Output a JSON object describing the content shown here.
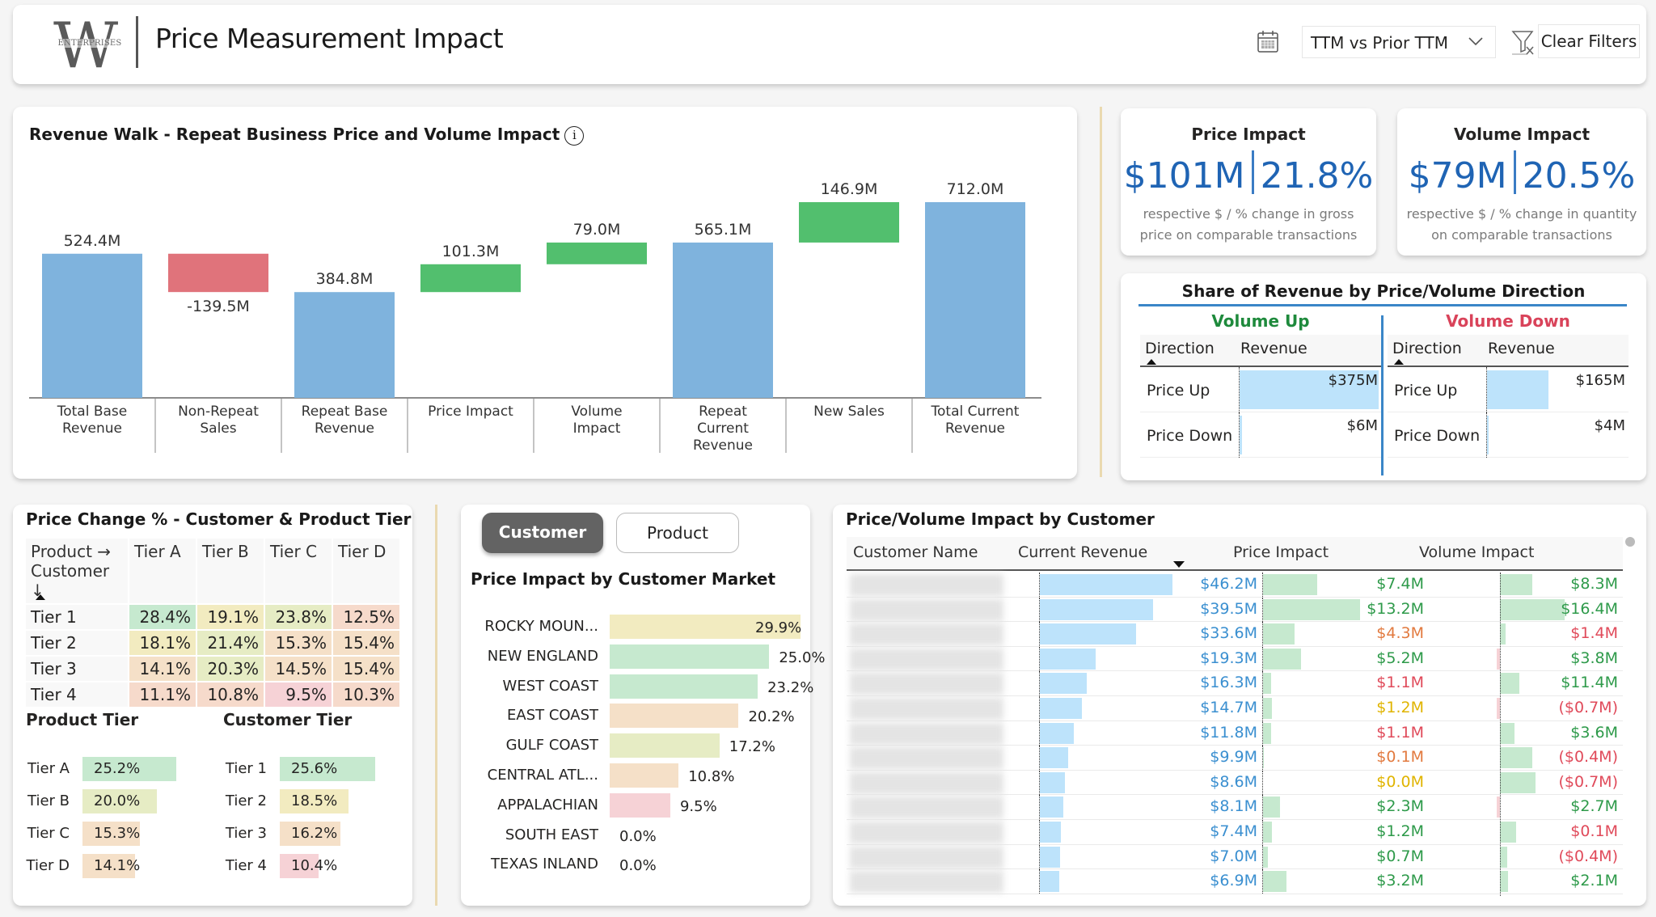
{
  "header": {
    "logo_letter": "W",
    "logo_text": "ENTERPRISES",
    "title": "Price Measurement Impact",
    "period_selected": "TTM vs Prior TTM",
    "clear_filters_label": "Clear Filters"
  },
  "colors": {
    "total_bar": "#7fb3dd",
    "increase_bar": "#52bf6e",
    "decrease_bar": "#e0737b",
    "kpi_value": "#1f64b4",
    "volume_up": "#1e8a3c",
    "volume_down": "#d9435a",
    "revenue_text": "#3a8fd0",
    "positive_text": "#2e9a4a",
    "negative_text": "#e04a5a",
    "warn_orange": "#e27a3f",
    "warn_yellow": "#e0b400",
    "green_fill": "#c6e9cf",
    "yellowgreen_fill": "#e6ecc4",
    "yellow_fill": "#f2ebc0",
    "orange_fill": "#f5e0c8",
    "pink_fill": "#f6d2d6",
    "blue_fill": "#bde3fb"
  },
  "walk": {
    "title": "Revenue Walk - Repeat Business Price and Volume Impact",
    "chart_data": {
      "type": "waterfall",
      "title": "Revenue Walk - Repeat Business Price and Volume Impact",
      "categories": [
        "Total Base Revenue",
        "Non-Repeat Sales",
        "Repeat Base Revenue",
        "Price Impact",
        "Volume Impact",
        "Repeat Current Revenue",
        "New Sales",
        "Total Current Revenue"
      ],
      "category_lines": [
        [
          "Total Base",
          "Revenue"
        ],
        [
          "Non-Repeat",
          "Sales"
        ],
        [
          "Repeat Base",
          "Revenue"
        ],
        [
          "Price Impact"
        ],
        [
          "Volume",
          "Impact"
        ],
        [
          "Repeat",
          "Current",
          "Revenue"
        ],
        [
          "New Sales"
        ],
        [
          "Total Current",
          "Revenue"
        ]
      ],
      "values": [
        524.4,
        -139.5,
        384.8,
        101.3,
        79.0,
        565.1,
        146.9,
        712.0
      ],
      "kinds": [
        "total",
        "decrease",
        "total",
        "increase",
        "increase",
        "total",
        "increase",
        "total"
      ],
      "labels": [
        "524.4M",
        "-139.5M",
        "384.8M",
        "101.3M",
        "79.0M",
        "565.1M",
        "146.9M",
        "712.0M"
      ],
      "ylim": [
        0,
        712.0
      ],
      "xlabel": "",
      "ylabel": ""
    }
  },
  "kpis": [
    {
      "title": "Price Impact",
      "amount": "$101M",
      "percent": "21.8%",
      "sub1": "respective $ / % change in gross",
      "sub2": "price on comparable transactions"
    },
    {
      "title": "Volume Impact",
      "amount": "$79M",
      "percent": "20.5%",
      "sub1": "respective $ / % change in quantity",
      "sub2": "on comparable transactions"
    }
  ],
  "share": {
    "title": "Share of Revenue by Price/Volume Direction",
    "col_direction": "Direction",
    "col_revenue": "Revenue",
    "max_value_m": 375,
    "groups": [
      {
        "title": "Volume Up",
        "rows": [
          {
            "direction": "Price Up",
            "value_m": 375,
            "label": "$375M"
          },
          {
            "direction": "Price Down",
            "value_m": 6,
            "label": "$6M"
          }
        ]
      },
      {
        "title": "Volume Down",
        "rows": [
          {
            "direction": "Price Up",
            "value_m": 165,
            "label": "$165M"
          },
          {
            "direction": "Price Down",
            "value_m": 4,
            "label": "$4M"
          }
        ]
      }
    ]
  },
  "price_change": {
    "title": "Price Change % - Customer & Product Tier",
    "corner_line1": "Product →",
    "corner_line2": "Customer ↓",
    "columns": [
      "Tier A",
      "Tier B",
      "Tier C",
      "Tier D"
    ],
    "rows": [
      {
        "label": "Tier 1",
        "cells": [
          {
            "v": "28.4%",
            "c": "green"
          },
          {
            "v": "19.1%",
            "c": "yellow"
          },
          {
            "v": "23.8%",
            "c": "yellowgreen"
          },
          {
            "v": "12.5%",
            "c": "salmon"
          }
        ]
      },
      {
        "label": "Tier 2",
        "cells": [
          {
            "v": "18.1%",
            "c": "yellow"
          },
          {
            "v": "21.4%",
            "c": "yellowgreen"
          },
          {
            "v": "15.3%",
            "c": "orange"
          },
          {
            "v": "15.4%",
            "c": "orange"
          }
        ]
      },
      {
        "label": "Tier 3",
        "cells": [
          {
            "v": "14.1%",
            "c": "orange"
          },
          {
            "v": "20.3%",
            "c": "yellowgreen"
          },
          {
            "v": "14.5%",
            "c": "orange"
          },
          {
            "v": "15.4%",
            "c": "orange"
          }
        ]
      },
      {
        "label": "Tier 4",
        "cells": [
          {
            "v": "11.1%",
            "c": "salmon"
          },
          {
            "v": "10.8%",
            "c": "salmon"
          },
          {
            "v": "9.5%",
            "c": "pink"
          },
          {
            "v": "10.3%",
            "c": "salmon"
          }
        ]
      }
    ],
    "product_tier": {
      "title": "Product Tier",
      "items": [
        {
          "label": "Tier A",
          "value": 25.2,
          "text": "25.2%",
          "c": "green"
        },
        {
          "label": "Tier B",
          "value": 20.0,
          "text": "20.0%",
          "c": "yellowgreen"
        },
        {
          "label": "Tier C",
          "value": 15.3,
          "text": "15.3%",
          "c": "orange"
        },
        {
          "label": "Tier D",
          "value": 14.1,
          "text": "14.1%",
          "c": "orange"
        }
      ]
    },
    "customer_tier": {
      "title": "Customer Tier",
      "items": [
        {
          "label": "Tier 1",
          "value": 25.6,
          "text": "25.6%",
          "c": "green"
        },
        {
          "label": "Tier 2",
          "value": 18.5,
          "text": "18.5%",
          "c": "yellow"
        },
        {
          "label": "Tier 3",
          "value": 16.2,
          "text": "16.2%",
          "c": "orange"
        },
        {
          "label": "Tier 4",
          "value": 10.4,
          "text": "10.4%",
          "c": "pink"
        }
      ]
    }
  },
  "market": {
    "toggle_customer": "Customer",
    "toggle_product": "Product",
    "active_toggle": "Customer",
    "title": "Price Impact by Customer Market",
    "chart_data": {
      "type": "bar",
      "orientation": "horizontal",
      "title": "Price Impact by Customer Market",
      "categories": [
        "ROCKY MOUN...",
        "NEW ENGLAND",
        "WEST COAST",
        "EAST COAST",
        "GULF COAST",
        "CENTRAL ATL...",
        "APPALACHIAN",
        "SOUTH EAST",
        "TEXAS INLAND"
      ],
      "values": [
        29.9,
        25.0,
        23.2,
        20.2,
        17.2,
        10.8,
        9.5,
        0.0,
        0.0
      ],
      "labels": [
        "29.9%",
        "25.0%",
        "23.2%",
        "20.2%",
        "17.2%",
        "10.8%",
        "9.5%",
        "0.0%",
        "0.0%"
      ],
      "colors": [
        "yellow",
        "green",
        "green",
        "orange",
        "yellowgreen",
        "orange",
        "pink",
        "none",
        "none"
      ],
      "xlim": [
        0,
        29.9
      ]
    }
  },
  "customers": {
    "title": "Price/Volume Impact by Customer",
    "columns": [
      "Customer Name",
      "Current Revenue",
      "Price Impact",
      "Volume Impact"
    ],
    "sorted_by": "Current Revenue",
    "rows": [
      {
        "revenue": 46.2,
        "revenue_label": "$46.2M",
        "price": 7.4,
        "price_label": "$7.4M",
        "price_color": "positive",
        "volume": 8.3,
        "volume_label": "$8.3M",
        "volume_color": "positive"
      },
      {
        "revenue": 39.5,
        "revenue_label": "$39.5M",
        "price": 13.2,
        "price_label": "$13.2M",
        "price_color": "positive",
        "volume": 16.4,
        "volume_label": "$16.4M",
        "volume_color": "positive"
      },
      {
        "revenue": 33.6,
        "revenue_label": "$33.6M",
        "price": 4.3,
        "price_label": "$4.3M",
        "price_color": "orange",
        "volume": 1.4,
        "volume_label": "$1.4M",
        "volume_color": "negative"
      },
      {
        "revenue": 19.3,
        "revenue_label": "$19.3M",
        "price": 5.2,
        "price_label": "$5.2M",
        "price_color": "positive",
        "volume": -0.2,
        "volume_label": "$3.8M",
        "volume_color": "positive"
      },
      {
        "revenue": 16.3,
        "revenue_label": "$16.3M",
        "price": 1.1,
        "price_label": "$1.1M",
        "price_color": "negative",
        "volume": 5.0,
        "volume_label": "$11.4M",
        "volume_color": "positive"
      },
      {
        "revenue": 14.7,
        "revenue_label": "$14.7M",
        "price": 1.2,
        "price_label": "$1.2M",
        "price_color": "yellow",
        "volume": -0.7,
        "volume_label": "($0.7M)",
        "volume_color": "negative"
      },
      {
        "revenue": 11.8,
        "revenue_label": "$11.8M",
        "price": 1.1,
        "price_label": "$1.1M",
        "price_color": "negative",
        "volume": 3.6,
        "volume_label": "$3.6M",
        "volume_color": "positive"
      },
      {
        "revenue": 9.9,
        "revenue_label": "$9.9M",
        "price": 0.1,
        "price_label": "$0.1M",
        "price_color": "orange",
        "volume": 8.3,
        "volume_label": "($0.4M)",
        "volume_color": "negative"
      },
      {
        "revenue": 8.6,
        "revenue_label": "$8.6M",
        "price": 0.0,
        "price_label": "$0.0M",
        "price_color": "yellow",
        "volume": 9.0,
        "volume_label": "($0.7M)",
        "volume_color": "negative"
      },
      {
        "revenue": 8.1,
        "revenue_label": "$8.1M",
        "price": 2.3,
        "price_label": "$2.3M",
        "price_color": "positive",
        "volume": -0.4,
        "volume_label": "$2.7M",
        "volume_color": "positive"
      },
      {
        "revenue": 7.4,
        "revenue_label": "$7.4M",
        "price": 1.2,
        "price_label": "$1.2M",
        "price_color": "positive",
        "volume": 4.0,
        "volume_label": "$0.1M",
        "volume_color": "negative"
      },
      {
        "revenue": 7.0,
        "revenue_label": "$7.0M",
        "price": 0.7,
        "price_label": "$0.7M",
        "price_color": "positive",
        "volume": 1.8,
        "volume_label": "($0.4M)",
        "volume_color": "negative"
      },
      {
        "revenue": 6.9,
        "revenue_label": "$6.9M",
        "price": 3.2,
        "price_label": "$3.2M",
        "price_color": "positive",
        "volume": 2.1,
        "volume_label": "$2.1M",
        "volume_color": "positive"
      }
    ]
  }
}
